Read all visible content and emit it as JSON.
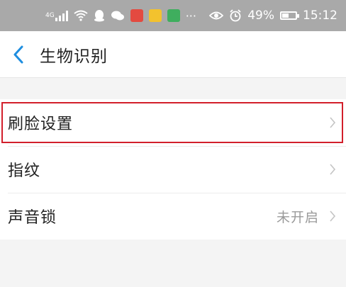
{
  "status_bar": {
    "network": "4G",
    "battery": "49%",
    "battery_level": 0.49,
    "time": "15:12",
    "icons": [
      "signal-icon",
      "wifi-icon",
      "qq-icon",
      "wechat-icon",
      "toutiao-icon",
      "baidu-icon",
      "app-icon",
      "more-icon",
      "eye-icon",
      "alarm-icon",
      "battery-icon"
    ]
  },
  "header": {
    "back_icon": "chevron-left-icon",
    "title": "生物识别"
  },
  "settings": {
    "items": [
      {
        "label": "刷脸设置",
        "value": "",
        "icon": "chevron-right-icon"
      },
      {
        "label": "指纹",
        "value": "",
        "icon": "chevron-right-icon"
      },
      {
        "label": "声音锁",
        "value": "未开启",
        "icon": "chevron-right-icon"
      }
    ]
  },
  "colors": {
    "accent": "#1e8ee0",
    "highlight": "#d21f2b",
    "status_bar": "#a9a9a9"
  }
}
